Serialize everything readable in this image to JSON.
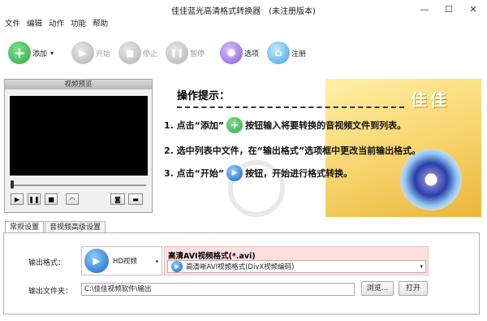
{
  "window": {
    "title": "佳佳蓝光高清格式转换器　(未注册版本)",
    "minimize": "—",
    "maximize": "☐",
    "close": "✕"
  },
  "menu": [
    "文件",
    "编辑",
    "动作",
    "功能",
    "帮助"
  ],
  "toolbar": {
    "add": "添加",
    "add_arrow": "▾",
    "start": "开始",
    "stop": "停止",
    "pause": "暂停",
    "options": "选项",
    "register": "注册"
  },
  "preview": {
    "title": "视频预览",
    "play": "▶",
    "pause": "❚❚",
    "stop": "■",
    "repeat": "◠",
    "snapshot": "◙",
    "folder": "▬"
  },
  "banner": {
    "heading": "操作提示：",
    "brand": "佳佳",
    "step1_pre": "1. 点击“添加”",
    "step1_post": "按钮输入将要转换的音视频文件到列表。",
    "step2": "2. 选中列表中文件，在“输出格式”选项框中更改当前输出格式。",
    "step3_pre": "3. 点击“开始”",
    "step3_post": "按钮，开始进行格式转换。",
    "plus_glyph": "+",
    "play_glyph": "▶"
  },
  "tabs": [
    "常规设置",
    "音视频高级设置"
  ],
  "settings": {
    "format_label": "输出格式：",
    "format_category": "HD视频",
    "format_title": "高清AVI视频格式(*.avi)",
    "format_detail": "高清晰AVI视频格式(DivX视频编码)",
    "folder_label": "输出文件夹：",
    "folder_path": "C:\\佳佳视频软件\\输出",
    "browse": "浏览...",
    "open": "打开",
    "dropdown_arrow": "▾"
  },
  "colors": {
    "add_green": "#2fa84a",
    "disabled_gray": "#b8b8b8",
    "options_purple": "#8a5ad0",
    "register_blue": "#3aa0e0",
    "banner_yellow": "#f7d36a"
  }
}
